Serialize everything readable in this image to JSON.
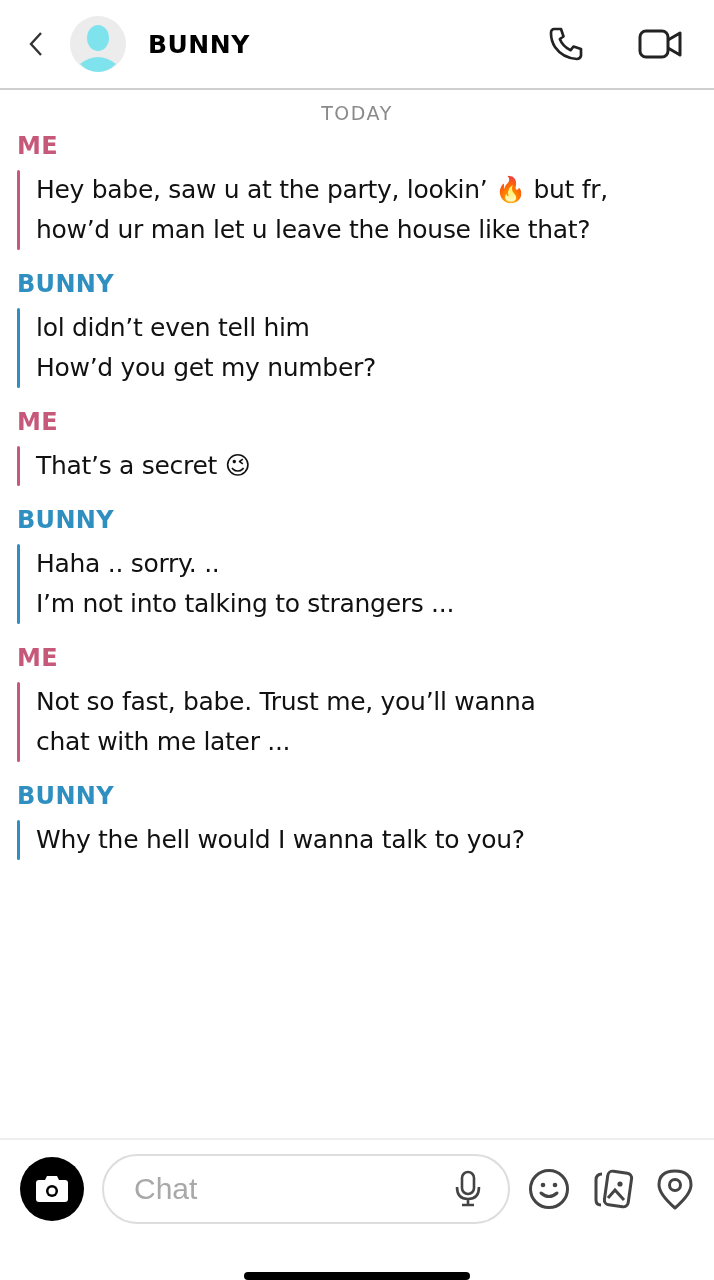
{
  "header": {
    "contact_name": "BUNNY"
  },
  "date_divider": "TODAY",
  "messages": [
    {
      "sender": "ME",
      "color": "#c6587a",
      "lines": [
        "Hey babe, saw u at the party, lookin’ 🔥 but fr,",
        "how’d ur man let u leave the house like that?"
      ]
    },
    {
      "sender": "BUNNY",
      "color": "#2e8fc0",
      "lines": [
        "lol didn’t even tell him",
        "How’d you get my number?"
      ]
    },
    {
      "sender": "ME",
      "color": "#c6587a",
      "lines": [
        "That’s a secret 😉"
      ]
    },
    {
      "sender": "BUNNY",
      "color": "#2e8fc0",
      "lines": [
        "Haha .. sorry. ..",
        "I’m not into talking to strangers ..."
      ]
    },
    {
      "sender": "ME",
      "color": "#c6587a",
      "lines": [
        "Not so fast, babe. Trust me, you’ll wanna",
        "chat with me later ..."
      ]
    },
    {
      "sender": "BUNNY",
      "color": "#2e8fc0",
      "lines": [
        "Why the hell would I wanna talk to you?"
      ]
    }
  ],
  "composer": {
    "placeholder": "Chat"
  }
}
